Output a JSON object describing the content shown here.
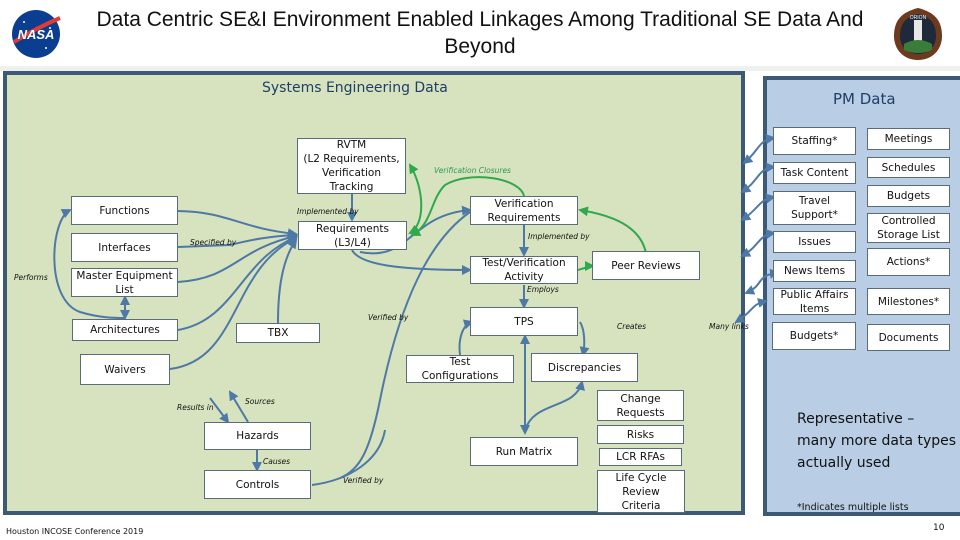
{
  "slide": {
    "title": "Data Centric SE&I Environment Enabled Linkages Among Traditional SE Data And Beyond",
    "logos": [
      "nasa-meatball-logo",
      "orion-ascent-abort-2-patch"
    ],
    "footer": "Houston INCOSE Conference 2019",
    "page_number": "10"
  },
  "se_panel": {
    "title": "Systems Engineering Data",
    "nodes": {
      "rvtm": "RVTM\n(L2 Requirements,\nVerification\nTracking",
      "functions": "Functions",
      "interfaces": "Interfaces",
      "master_equipment_list": "Master Equipment\nList",
      "architectures": "Architectures",
      "waivers": "Waivers",
      "tbx": "TBX",
      "requirements": "Requirements\n(L3/L4)",
      "verification_requirements": "Verification\nRequirements",
      "test_verification_activity": "Test/Verification\nActivity",
      "peer_reviews": "Peer Reviews",
      "tps": "TPS",
      "test_configurations": "Test\nConfigurations",
      "discrepancies": "Discrepancies",
      "hazards": "Hazards",
      "controls": "Controls",
      "run_matrix": "Run Matrix",
      "change_requests": "Change\nRequests",
      "risks": "Risks",
      "lcr_rfas": "LCR RFAs",
      "life_cycle_review_criteria": "Life Cycle\nReview\nCriteria"
    },
    "link_labels": {
      "performs": "Performs",
      "specified_by": "Specified by",
      "implemented_by_rvtm": "Implemented by",
      "verification_closures": "Verification Closures",
      "implemented_by_vr": "Implemented by",
      "employs": "Employs",
      "verified_by_req": "Verified by",
      "creates": "Creates",
      "results_in": "Results in",
      "sources": "Sources",
      "causes": "Causes",
      "verified_by_controls": "Verified by",
      "many_links": "Many links"
    }
  },
  "pm_panel": {
    "title": "PM Data",
    "left_column": [
      "Staffing*",
      "Task Content",
      "Travel\nSupport*",
      "Issues",
      "News Items",
      "Public Affairs\nItems",
      "Budgets*"
    ],
    "right_column": [
      "Meetings",
      "Schedules",
      "Budgets",
      "Controlled\nStorage List",
      "Actions*",
      "Milestones*",
      "Documents"
    ],
    "note": "Representative – many more data types actually used",
    "footnote": "*Indicates multiple lists"
  },
  "colors": {
    "se_background": "#d7e3bf",
    "pm_background": "#b9cde4",
    "panel_border": "#3c5a78",
    "link_blue": "#4e79a7",
    "link_green": "#2fa84f",
    "title_blue": "#1f3f68"
  }
}
